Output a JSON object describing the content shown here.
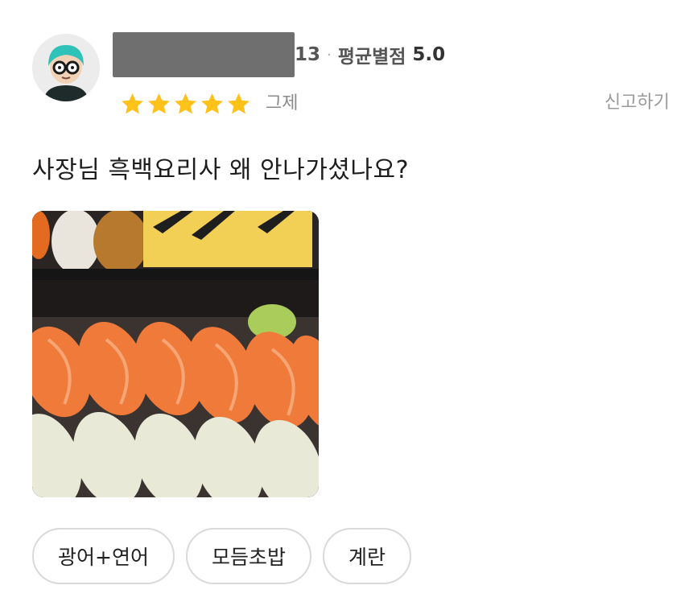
{
  "review": {
    "reviewer_count_suffix": "13",
    "separator": "·",
    "avg_rating_label": "평균별점",
    "avg_rating_value": "5.0",
    "stars": 5,
    "ordered_item": "그제",
    "report_label": "신고하기",
    "text": "사장님 흑백요리사 왜 안나가셨나요?"
  },
  "tags": [
    {
      "label": "광어+연어"
    },
    {
      "label": "모듬초밥"
    },
    {
      "label": "계란"
    }
  ],
  "colors": {
    "star": "#FFC21A",
    "salmon": "#F27A3A",
    "tag_border": "#D9D9D9",
    "muted_text": "#9A9A9A"
  }
}
